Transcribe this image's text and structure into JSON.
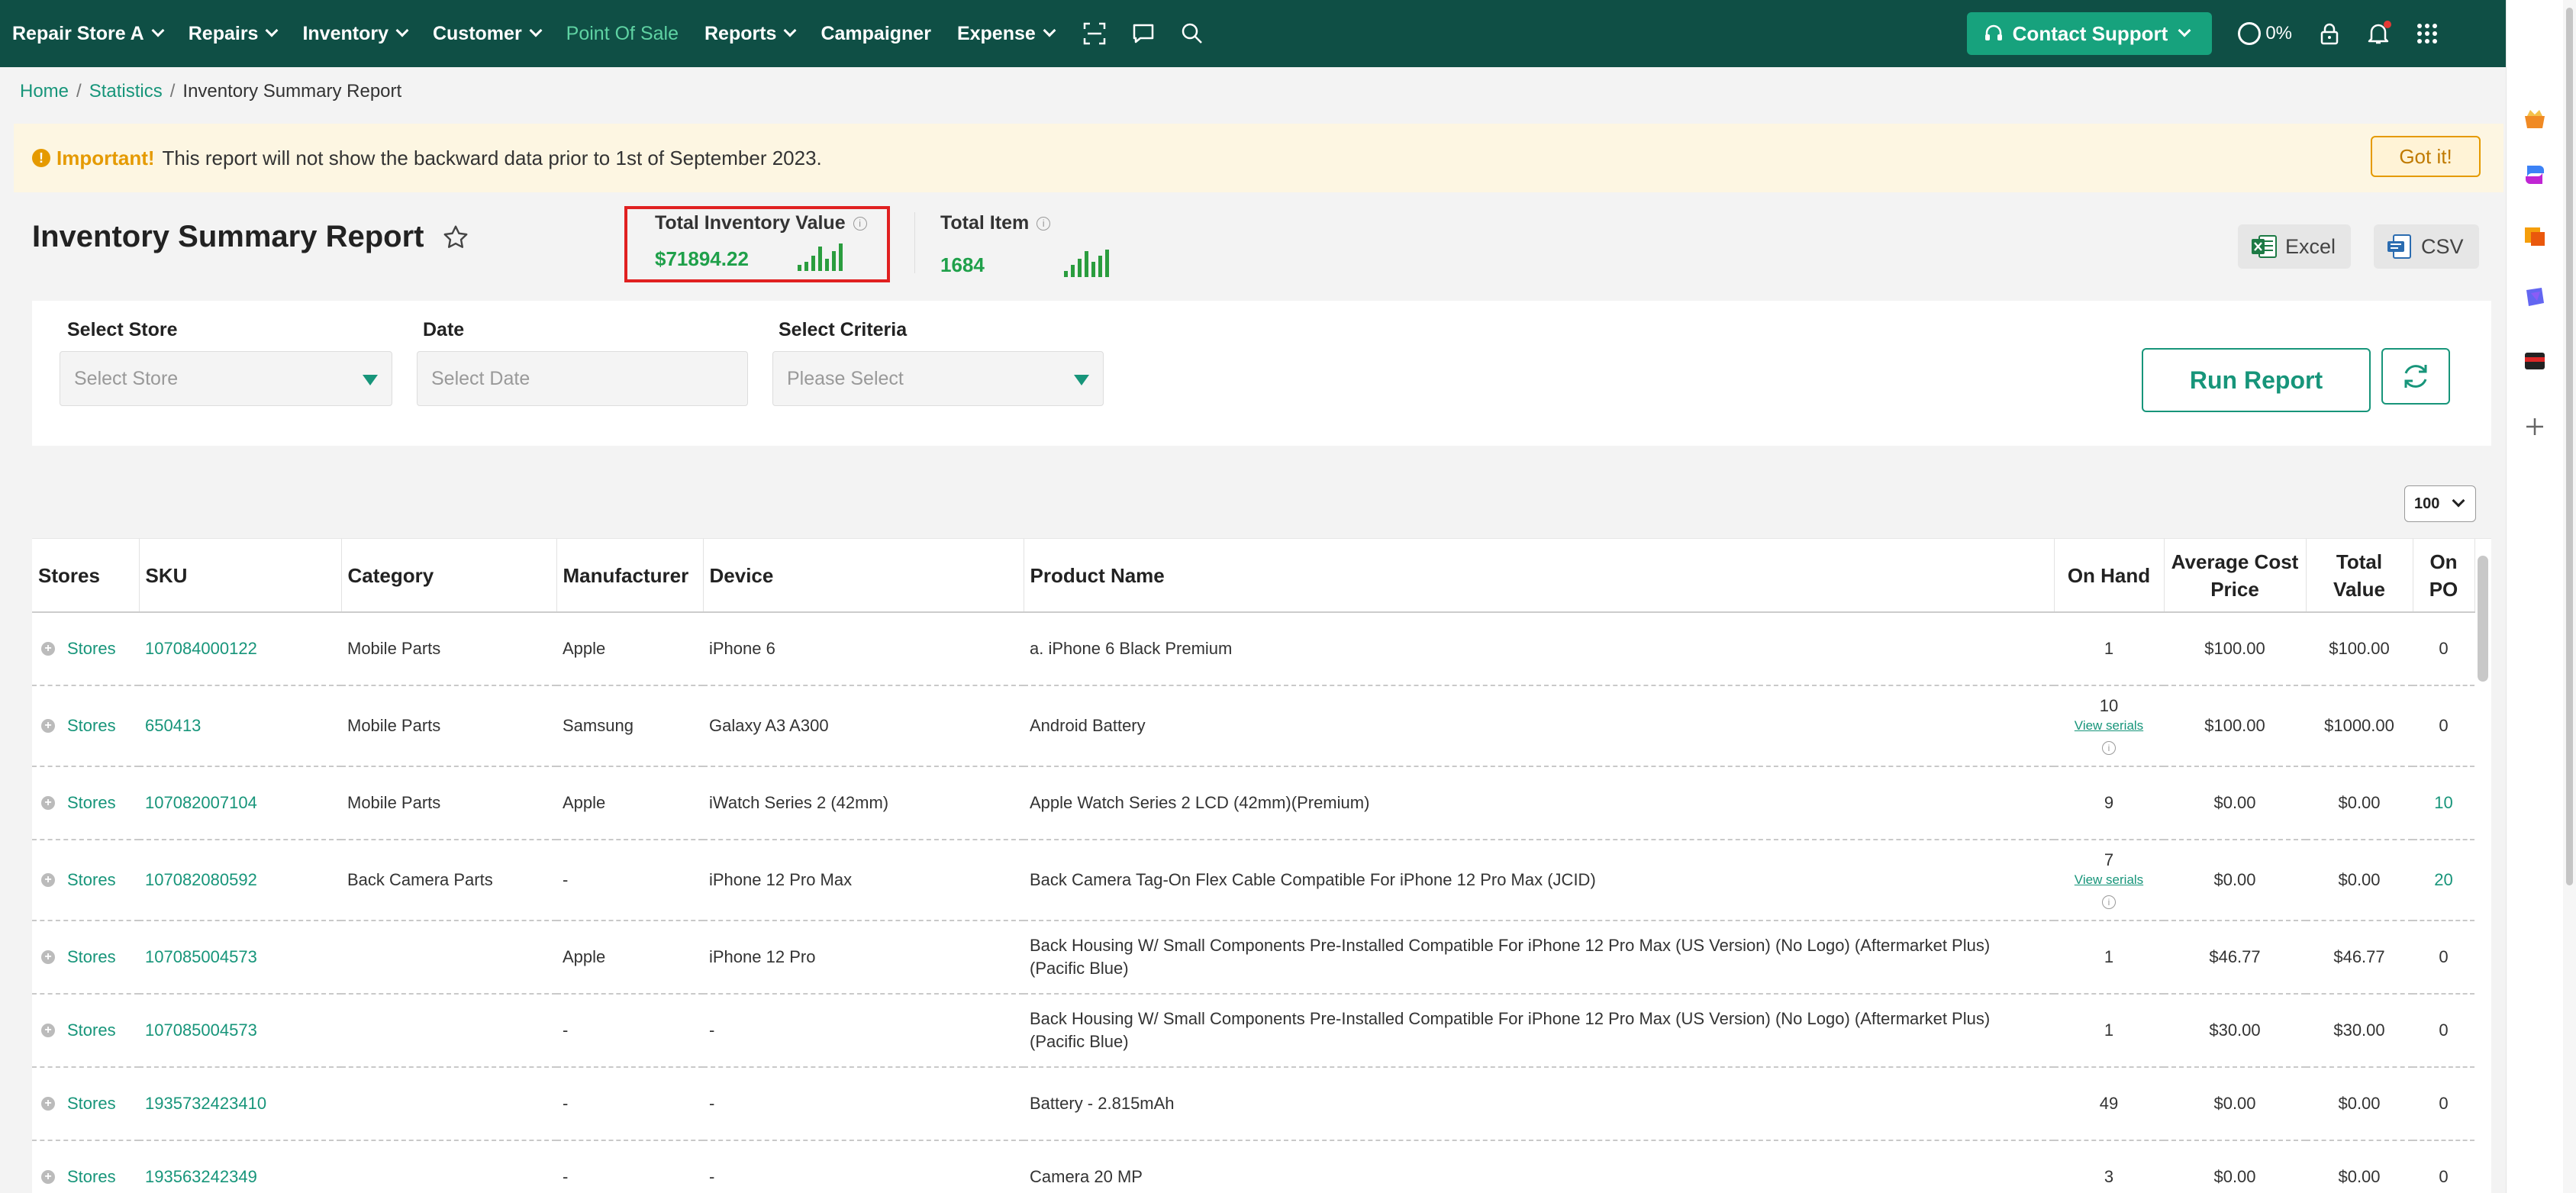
{
  "nav": {
    "store": "Repair Store A",
    "items": [
      {
        "label": "Repairs"
      },
      {
        "label": "Inventory"
      },
      {
        "label": "Customer"
      }
    ],
    "pos": "Point Of Sale",
    "reports": "Reports",
    "campaigner": "Campaigner",
    "expense": "Expense",
    "contact_support": "Contact Support",
    "progress": "0%"
  },
  "breadcrumb": {
    "home": "Home",
    "statistics": "Statistics",
    "current": "Inventory Summary Report"
  },
  "notice": {
    "important": "Important!",
    "message": "This report will not show the backward data prior to 1st of September 2023.",
    "got_it": "Got it!"
  },
  "page": {
    "title": "Inventory Summary Report",
    "total_inventory_value_label": "Total Inventory Value",
    "total_inventory_value": "$71894.22",
    "total_item_label": "Total Item",
    "total_item": "1684",
    "excel": "Excel",
    "csv": "CSV"
  },
  "filters": {
    "store_label": "Select Store",
    "store_placeholder": "Select Store",
    "date_label": "Date",
    "date_placeholder": "Select Date",
    "criteria_label": "Select Criteria",
    "criteria_placeholder": "Please Select",
    "run_report": "Run Report"
  },
  "table": {
    "page_size": "100",
    "columns": {
      "stores": "Stores",
      "sku": "SKU",
      "category": "Category",
      "manufacturer": "Manufacturer",
      "device": "Device",
      "product": "Product Name",
      "on_hand": "On Hand",
      "avg_cost_1": "Average Cost",
      "avg_cost_2": "Price",
      "total_value_1": "Total",
      "total_value_2": "Value",
      "on_po_1": "On",
      "on_po_2": "PO"
    },
    "view_serials": "View serials",
    "rows": [
      {
        "stores": "Stores",
        "sku": "107084000122",
        "category": "Mobile Parts",
        "manufacturer": "Apple",
        "device": "iPhone 6",
        "product": "a. iPhone 6 Black Premium",
        "on_hand": "1",
        "serials": false,
        "avg_cost": "$100.00",
        "total_value": "$100.00",
        "on_po": "0",
        "po_link": false
      },
      {
        "stores": "Stores",
        "sku": "650413",
        "category": "Mobile Parts",
        "manufacturer": "Samsung",
        "device": "Galaxy A3 A300",
        "product": "Android Battery",
        "on_hand": "10",
        "serials": true,
        "avg_cost": "$100.00",
        "total_value": "$1000.00",
        "on_po": "0",
        "po_link": false
      },
      {
        "stores": "Stores",
        "sku": "107082007104",
        "category": "Mobile Parts",
        "manufacturer": "Apple",
        "device": "iWatch Series 2 (42mm)",
        "product": "Apple Watch Series 2 LCD (42mm)(Premium)",
        "on_hand": "9",
        "serials": false,
        "avg_cost": "$0.00",
        "total_value": "$0.00",
        "on_po": "10",
        "po_link": true
      },
      {
        "stores": "Stores",
        "sku": "107082080592",
        "category": "Back Camera Parts",
        "manufacturer": "-",
        "device": "iPhone 12 Pro Max",
        "product": "Back Camera Tag-On Flex Cable Compatible For iPhone 12 Pro Max (JCID)",
        "on_hand": "7",
        "serials": true,
        "avg_cost": "$0.00",
        "total_value": "$0.00",
        "on_po": "20",
        "po_link": true
      },
      {
        "stores": "Stores",
        "sku": "107085004573",
        "category": "",
        "manufacturer": "Apple",
        "device": "iPhone 12 Pro",
        "product": "Back Housing W/ Small Components Pre-Installed Compatible For iPhone 12 Pro Max (US Version) (No Logo) (Aftermarket Plus) (Pacific Blue)",
        "on_hand": "1",
        "serials": false,
        "avg_cost": "$46.77",
        "total_value": "$46.77",
        "on_po": "0",
        "po_link": false
      },
      {
        "stores": "Stores",
        "sku": "107085004573",
        "category": "",
        "manufacturer": "-",
        "device": "-",
        "product": "Back Housing W/ Small Components Pre-Installed Compatible For iPhone 12 Pro Max (US Version) (No Logo) (Aftermarket Plus) (Pacific Blue)",
        "on_hand": "1",
        "serials": false,
        "avg_cost": "$30.00",
        "total_value": "$30.00",
        "on_po": "0",
        "po_link": false
      },
      {
        "stores": "Stores",
        "sku": "1935732423410",
        "category": "",
        "manufacturer": "-",
        "device": "-",
        "product": "Battery - 2.815mAh",
        "on_hand": "49",
        "serials": false,
        "avg_cost": "$0.00",
        "total_value": "$0.00",
        "on_po": "0",
        "po_link": false
      },
      {
        "stores": "Stores",
        "sku": "193563242349",
        "category": "",
        "manufacturer": "-",
        "device": "-",
        "product": "Camera 20 MP",
        "on_hand": "3",
        "serials": false,
        "avg_cost": "$0.00",
        "total_value": "$0.00",
        "on_po": "0",
        "po_link": false
      }
    ]
  },
  "colors": {
    "nav_bg": "#0f4f45",
    "accent": "#17957a",
    "value_green": "#1fa04a",
    "highlight_red": "#e02020"
  }
}
